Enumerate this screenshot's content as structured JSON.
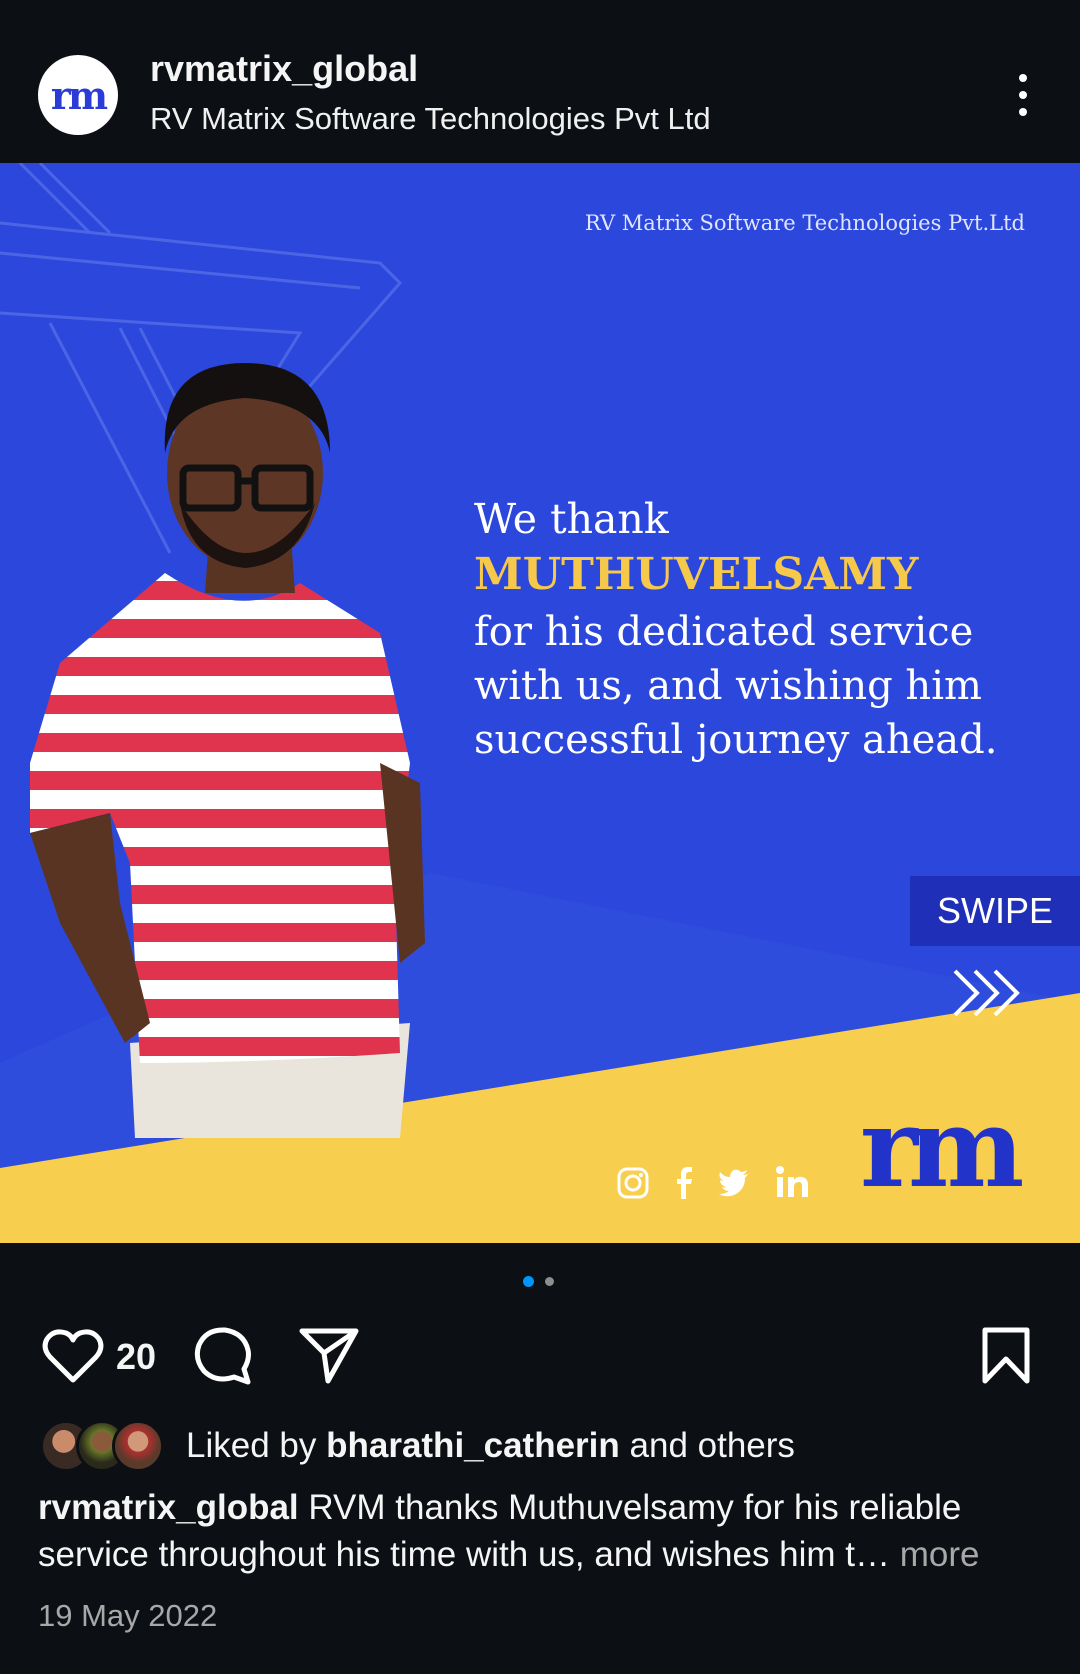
{
  "header": {
    "username": "rvmatrix_global",
    "subtitle": "RV Matrix Software Technologies Pvt Ltd",
    "more_icon": "more-vertical-icon"
  },
  "post_image": {
    "company_text": "RV Matrix Software Technologies Pvt.Ltd",
    "line1": "We thank",
    "name": "MUTHUVELSAMY",
    "line3": "for his dedicated service",
    "line4": "with us, and wishing him",
    "line5": "successful journey ahead.",
    "swipe_label": "SWIPE",
    "social_icons": [
      "instagram-icon",
      "facebook-icon",
      "twitter-icon",
      "linkedin-icon"
    ],
    "brand_logo": "rm",
    "colors": {
      "background": "#2c48dc",
      "accent_yellow": "#f8ce4e",
      "name_color": "#f6c94a"
    }
  },
  "carousel": {
    "total": 2,
    "active": 1
  },
  "actions": {
    "like_count": "20",
    "icons": [
      "heart-icon",
      "comment-icon",
      "share-icon",
      "bookmark-icon"
    ]
  },
  "liked_by": {
    "prefix": "Liked by ",
    "user": "bharathi_catherin",
    "suffix": " and others"
  },
  "caption": {
    "username": "rvmatrix_global",
    "text": " RVM thanks Muthuvelsamy for his reliable service throughout his time with us, and wishes him t",
    "ellipsis": "… ",
    "more": "more"
  },
  "date": "19 May 2022"
}
